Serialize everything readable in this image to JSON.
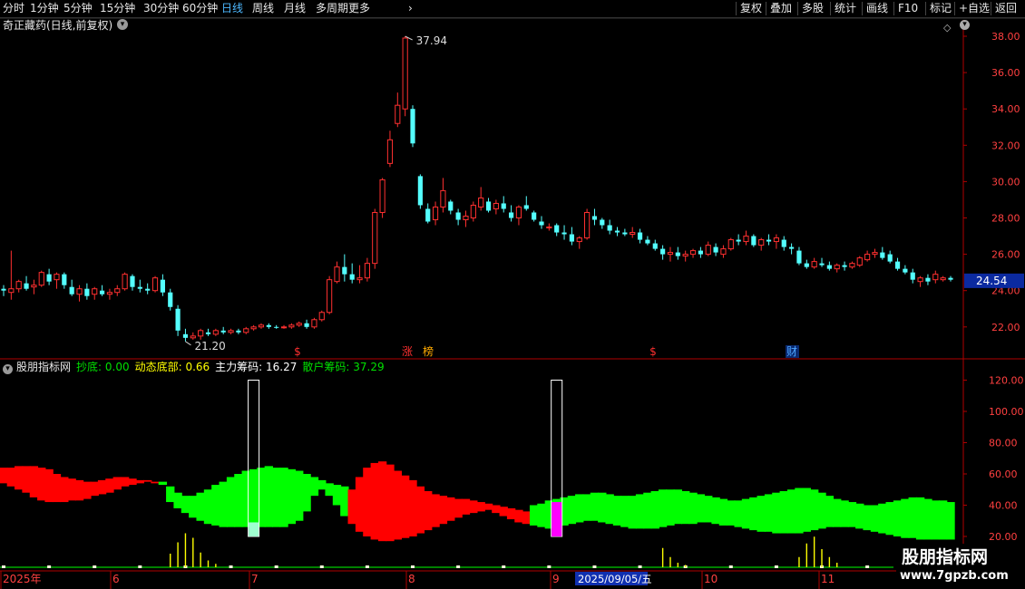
{
  "toolbar": {
    "periods": [
      "分时",
      "1分钟",
      "5分钟",
      "15分钟",
      "30分钟",
      "60分钟",
      "日线",
      "周线",
      "月线",
      "多周期",
      "更多"
    ],
    "selected_period": "日线",
    "right_buttons": [
      "复权",
      "叠加",
      "多股",
      "统计",
      "画线",
      "F10",
      "标记",
      "+自选",
      "返回"
    ]
  },
  "main_panel": {
    "title": "奇正藏药(日线,前复权)",
    "high_label": "37.94",
    "low_label": "21.20",
    "current_price": "24.54",
    "event_markers": [
      {
        "text": "$",
        "color": "#ff3030"
      },
      {
        "text": "涨",
        "color": "#ff3030"
      },
      {
        "text": "榜",
        "color": "#ffaa00"
      },
      {
        "text": "$",
        "color": "#ff3030"
      },
      {
        "text": "财",
        "color": "#4da6ff"
      }
    ]
  },
  "indicator_panel": {
    "name": "股朋指标网",
    "values": [
      {
        "label": "抄底: 0.00",
        "color": "#00e000"
      },
      {
        "label": "动态底部: 0.66",
        "color": "#ffff00"
      },
      {
        "label": "主力筹码: 16.27",
        "color": "#ffffff"
      },
      {
        "label": "散户筹码: 37.29",
        "color": "#00e000"
      }
    ]
  },
  "date_axis": {
    "labels": [
      "2025年",
      "6",
      "7",
      "8",
      "9",
      "10",
      "11"
    ],
    "cursor_date": "2025/09/05/五"
  },
  "watermark": {
    "title": "股朋指标网",
    "url": "www.7gpzb.com"
  },
  "colors": {
    "up": "#ff3030",
    "down": "#54ffff",
    "axis": "#b00000",
    "green": "#00ff00",
    "red": "#ff0000",
    "magenta": "#ff00ff",
    "accent": "#4db8ff"
  },
  "chart_data": {
    "type": "candlestick",
    "ylim": [
      21,
      39
    ],
    "yticks": [
      "22.00",
      "24.00",
      "26.00",
      "28.00",
      "30.00",
      "32.00",
      "34.00",
      "36.00",
      "38.00"
    ],
    "ohlc": [
      [
        24.1,
        24.3,
        23.7,
        24.0
      ],
      [
        23.9,
        26.2,
        23.5,
        24.1
      ],
      [
        24.1,
        24.6,
        23.9,
        24.5
      ],
      [
        24.4,
        24.8,
        24.0,
        24.1
      ],
      [
        24.2,
        24.6,
        23.8,
        24.3
      ],
      [
        24.3,
        25.1,
        24.2,
        25.0
      ],
      [
        24.9,
        25.2,
        24.3,
        24.5
      ],
      [
        24.6,
        25.0,
        24.1,
        24.9
      ],
      [
        24.9,
        25.0,
        24.1,
        24.3
      ],
      [
        24.2,
        24.6,
        23.7,
        23.8
      ],
      [
        23.8,
        24.3,
        23.4,
        24.1
      ],
      [
        24.1,
        24.4,
        23.5,
        23.7
      ],
      [
        23.8,
        24.2,
        23.5,
        24.1
      ],
      [
        24.0,
        24.3,
        23.7,
        23.8
      ],
      [
        23.8,
        24.1,
        23.5,
        23.9
      ],
      [
        23.9,
        24.3,
        23.7,
        24.1
      ],
      [
        24.1,
        25.0,
        24.0,
        24.9
      ],
      [
        24.8,
        24.9,
        24.0,
        24.2
      ],
      [
        24.2,
        24.6,
        23.9,
        24.1
      ],
      [
        24.1,
        24.4,
        23.8,
        24.0
      ],
      [
        24.0,
        24.8,
        23.9,
        24.7
      ],
      [
        24.6,
        24.9,
        23.7,
        23.9
      ],
      [
        23.9,
        24.1,
        22.9,
        23.1
      ],
      [
        23.0,
        23.2,
        21.5,
        21.8
      ],
      [
        21.6,
        21.9,
        21.2,
        21.4
      ],
      [
        21.4,
        21.7,
        21.3,
        21.5
      ],
      [
        21.5,
        21.9,
        21.3,
        21.8
      ],
      [
        21.7,
        21.9,
        21.5,
        21.6
      ],
      [
        21.6,
        21.9,
        21.5,
        21.8
      ],
      [
        21.8,
        22.0,
        21.6,
        21.7
      ],
      [
        21.7,
        21.9,
        21.6,
        21.8
      ],
      [
        21.8,
        21.9,
        21.6,
        21.7
      ],
      [
        21.7,
        22.0,
        21.6,
        21.9
      ],
      [
        21.9,
        22.1,
        21.8,
        22.0
      ],
      [
        22.0,
        22.2,
        21.9,
        22.1
      ],
      [
        22.1,
        22.2,
        21.9,
        22.0
      ],
      [
        22.0,
        22.1,
        21.9,
        21.95
      ],
      [
        21.95,
        22.1,
        21.9,
        22.0
      ],
      [
        22.0,
        22.2,
        21.9,
        22.1
      ],
      [
        22.1,
        22.3,
        22.0,
        22.2
      ],
      [
        22.2,
        22.4,
        21.9,
        22.0
      ],
      [
        22.0,
        22.5,
        21.9,
        22.4
      ],
      [
        22.4,
        22.9,
        22.3,
        22.8
      ],
      [
        22.8,
        24.8,
        22.7,
        24.6
      ],
      [
        24.5,
        25.6,
        24.4,
        25.3
      ],
      [
        25.3,
        26.0,
        24.5,
        24.9
      ],
      [
        24.9,
        25.5,
        24.4,
        24.6
      ],
      [
        24.6,
        25.4,
        24.4,
        24.7
      ],
      [
        24.7,
        25.8,
        24.5,
        25.5
      ],
      [
        25.5,
        28.5,
        25.2,
        28.3
      ],
      [
        28.3,
        30.2,
        28.0,
        30.1
      ],
      [
        31.0,
        32.8,
        30.8,
        32.3
      ],
      [
        33.2,
        34.9,
        33.0,
        34.2
      ],
      [
        34.0,
        38.0,
        33.6,
        37.9
      ],
      [
        34.0,
        34.2,
        31.9,
        32.1
      ],
      [
        30.3,
        30.4,
        28.5,
        28.7
      ],
      [
        28.5,
        28.8,
        27.7,
        27.8
      ],
      [
        27.9,
        28.9,
        27.6,
        28.6
      ],
      [
        28.6,
        30.2,
        28.3,
        29.5
      ],
      [
        28.9,
        29.0,
        28.2,
        28.4
      ],
      [
        28.3,
        28.5,
        27.6,
        27.9
      ],
      [
        27.9,
        28.4,
        27.5,
        28.1
      ],
      [
        28.0,
        28.9,
        27.8,
        28.7
      ],
      [
        28.6,
        29.7,
        28.4,
        29.1
      ],
      [
        28.9,
        29.1,
        28.3,
        28.4
      ],
      [
        28.5,
        29.0,
        28.2,
        28.8
      ],
      [
        28.8,
        29.2,
        28.3,
        28.5
      ],
      [
        28.3,
        28.7,
        27.8,
        28.0
      ],
      [
        28.0,
        28.7,
        27.6,
        28.6
      ],
      [
        28.7,
        29.2,
        28.4,
        28.5
      ],
      [
        28.3,
        28.4,
        27.8,
        27.9
      ],
      [
        27.8,
        28.1,
        27.4,
        27.6
      ],
      [
        27.5,
        27.7,
        27.3,
        27.5
      ],
      [
        27.6,
        27.7,
        27.0,
        27.2
      ],
      [
        27.2,
        27.6,
        26.8,
        27.1
      ],
      [
        27.1,
        27.5,
        26.5,
        26.7
      ],
      [
        26.7,
        27.0,
        26.3,
        26.9
      ],
      [
        26.9,
        28.5,
        26.8,
        28.3
      ],
      [
        28.1,
        28.5,
        27.6,
        27.9
      ],
      [
        27.9,
        28.0,
        27.4,
        27.6
      ],
      [
        27.6,
        27.9,
        27.1,
        27.3
      ],
      [
        27.3,
        27.5,
        27.0,
        27.2
      ],
      [
        27.2,
        27.4,
        27.0,
        27.1
      ],
      [
        27.1,
        27.5,
        26.9,
        27.2
      ],
      [
        27.2,
        27.4,
        26.6,
        26.8
      ],
      [
        26.8,
        27.0,
        26.5,
        26.6
      ],
      [
        26.6,
        26.8,
        26.2,
        26.3
      ],
      [
        26.3,
        26.5,
        25.7,
        26.0
      ],
      [
        26.0,
        26.4,
        25.6,
        26.1
      ],
      [
        26.1,
        26.4,
        25.7,
        25.9
      ],
      [
        25.9,
        26.2,
        25.6,
        26.0
      ],
      [
        26.0,
        26.3,
        25.8,
        26.2
      ],
      [
        26.2,
        26.4,
        25.8,
        26.0
      ],
      [
        26.0,
        26.7,
        25.9,
        26.5
      ],
      [
        26.4,
        26.6,
        25.9,
        26.1
      ],
      [
        26.0,
        26.5,
        25.8,
        26.3
      ],
      [
        26.3,
        26.9,
        26.2,
        26.8
      ],
      [
        26.8,
        27.1,
        26.5,
        26.7
      ],
      [
        26.7,
        27.3,
        26.5,
        27.0
      ],
      [
        27.0,
        27.1,
        26.4,
        26.5
      ],
      [
        26.5,
        26.9,
        26.2,
        26.8
      ],
      [
        26.8,
        27.1,
        26.5,
        26.7
      ],
      [
        26.7,
        27.1,
        26.3,
        26.9
      ],
      [
        26.8,
        27.0,
        26.2,
        26.4
      ],
      [
        26.4,
        26.6,
        26.0,
        26.3
      ],
      [
        26.2,
        26.4,
        25.4,
        25.5
      ],
      [
        25.5,
        25.7,
        25.2,
        25.3
      ],
      [
        25.3,
        25.8,
        25.2,
        25.6
      ],
      [
        25.5,
        25.8,
        25.3,
        25.4
      ],
      [
        25.4,
        25.6,
        25.1,
        25.2
      ],
      [
        25.2,
        25.5,
        25.0,
        25.4
      ],
      [
        25.4,
        25.6,
        25.1,
        25.3
      ],
      [
        25.3,
        25.6,
        25.2,
        25.5
      ],
      [
        25.4,
        25.9,
        25.3,
        25.8
      ],
      [
        25.7,
        26.2,
        25.6,
        26.0
      ],
      [
        26.0,
        26.3,
        25.8,
        26.1
      ],
      [
        26.1,
        26.4,
        25.7,
        25.8
      ],
      [
        26.0,
        26.2,
        25.5,
        25.6
      ],
      [
        25.6,
        25.8,
        25.1,
        25.2
      ],
      [
        25.2,
        25.4,
        24.9,
        25.0
      ],
      [
        25.0,
        25.2,
        24.4,
        24.6
      ],
      [
        24.5,
        24.8,
        24.2,
        24.7
      ],
      [
        24.7,
        24.9,
        24.3,
        24.5
      ],
      [
        24.6,
        25.1,
        24.4,
        24.9
      ],
      [
        24.6,
        24.8,
        24.5,
        24.7
      ],
      [
        24.7,
        24.8,
        24.5,
        24.6
      ]
    ],
    "indicator": {
      "ylim": [
        15,
        125
      ],
      "yticks": [
        "20.00",
        "40.00",
        "60.00",
        "80.00",
        "100.00",
        "120.00"
      ],
      "main_chip_upper": [
        64,
        64,
        65,
        65,
        65,
        64,
        63,
        60,
        58,
        57,
        56,
        55,
        55,
        56,
        57,
        58,
        58,
        57,
        56,
        56,
        55,
        55,
        52,
        48,
        46,
        46,
        48,
        50,
        53,
        55,
        58,
        60,
        62,
        63,
        64,
        65,
        64,
        64,
        63,
        62,
        60,
        58,
        56,
        54,
        53,
        52,
        50,
        58,
        64,
        67,
        68,
        66,
        62,
        59,
        56,
        52,
        49,
        47,
        46,
        45,
        44,
        44,
        43,
        42,
        41,
        40,
        39,
        38,
        37,
        36,
        40,
        41,
        43,
        44,
        45,
        46,
        47,
        47,
        48,
        48,
        47,
        46,
        46,
        46,
        47,
        48,
        49,
        50,
        50,
        50,
        49,
        48,
        47,
        46,
        45,
        44,
        43,
        43,
        44,
        45,
        46,
        47,
        48,
        49,
        50,
        51,
        51,
        50,
        48,
        46,
        44,
        43,
        42,
        41,
        40,
        40,
        41,
        42,
        43,
        44,
        45,
        45,
        44,
        43,
        43,
        42,
        42,
        42,
        42
      ],
      "main_chip_lower": [
        54,
        52,
        50,
        48,
        45,
        43,
        42,
        42,
        42,
        43,
        43,
        44,
        46,
        47,
        48,
        50,
        52,
        53,
        54,
        55,
        54,
        53,
        42,
        38,
        35,
        32,
        30,
        28,
        27,
        26,
        26,
        26,
        26,
        26,
        26,
        26,
        26,
        26,
        28,
        30,
        36,
        46,
        50,
        46,
        40,
        33,
        28,
        23,
        20,
        18,
        17,
        17,
        18,
        19,
        20,
        22,
        24,
        26,
        28,
        30,
        32,
        34,
        35,
        36,
        37,
        35,
        33,
        31,
        29,
        28,
        27,
        26,
        25,
        26,
        27,
        28,
        29,
        30,
        30,
        29,
        28,
        27,
        26,
        25,
        25,
        25,
        25,
        26,
        27,
        28,
        28,
        28,
        29,
        29,
        28,
        27,
        27,
        26,
        25,
        24,
        23,
        23,
        22,
        22,
        22,
        22,
        23,
        24,
        25,
        26,
        26,
        26,
        26,
        25,
        24,
        23,
        22,
        21,
        20,
        19,
        19,
        18,
        18,
        18,
        18,
        18,
        18,
        18,
        18
      ],
      "segments": [
        {
          "from": 0,
          "to": 20,
          "color": "red"
        },
        {
          "from": 21,
          "to": 45,
          "color": "green"
        },
        {
          "from": 46,
          "to": 69,
          "color": "red"
        },
        {
          "from": 70,
          "to": 128,
          "color": "green"
        }
      ],
      "outline_bars": [
        {
          "index": 33,
          "top": 120,
          "fill_top": 29,
          "fill_color": "#a0ffd0"
        },
        {
          "index": 73,
          "top": 120,
          "fill_top": 42,
          "fill_color": "#ff00ff"
        }
      ],
      "volume_spikes": [
        {
          "index": 22,
          "value": 12
        },
        {
          "index": 23,
          "value": 22
        },
        {
          "index": 24,
          "value": 30
        },
        {
          "index": 25,
          "value": 26
        },
        {
          "index": 26,
          "value": 13
        },
        {
          "index": 27,
          "value": 6
        },
        {
          "index": 28,
          "value": 3
        },
        {
          "index": 87,
          "value": 17
        },
        {
          "index": 88,
          "value": 9
        },
        {
          "index": 89,
          "value": 4
        },
        {
          "index": 90,
          "value": 2
        },
        {
          "index": 105,
          "value": 9
        },
        {
          "index": 106,
          "value": 21
        },
        {
          "index": 107,
          "value": 27
        },
        {
          "index": 108,
          "value": 16
        },
        {
          "index": 109,
          "value": 9
        },
        {
          "index": 110,
          "value": 4
        }
      ]
    }
  }
}
